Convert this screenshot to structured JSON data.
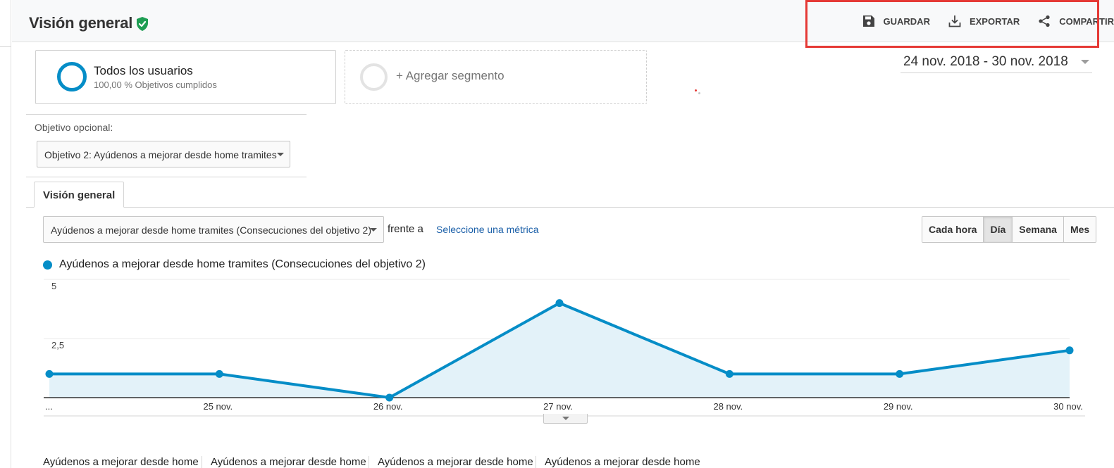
{
  "header": {
    "title": "Visión general",
    "actions": {
      "save": "GUARDAR",
      "export": "EXPORTAR",
      "share": "COMPARTIR"
    }
  },
  "segments": {
    "primary": {
      "name": "Todos los usuarios",
      "detail": "100,00 % Objetivos cumplidos"
    },
    "add_label": "+ Agregar segmento"
  },
  "date_range": "24 nov. 2018 - 30 nov. 2018",
  "goal_option": {
    "label": "Objetivo opcional:",
    "selected": "Objetivo 2: Ayúdenos a mejorar desde home tramites"
  },
  "tabs": [
    {
      "label": "Visión general",
      "active": true
    }
  ],
  "metric_controls": {
    "selected_metric": "Ayúdenos a mejorar desde home tramites (Consecuciones del objetivo 2)",
    "versus_label": "frente a",
    "select_metric_link": "Seleccione una métrica",
    "periods": [
      "Cada hora",
      "Día",
      "Semana",
      "Mes"
    ],
    "active_period": "Día"
  },
  "colors": {
    "accent": "#058dc7",
    "area_fill": "#e3f2f9",
    "highlight": "#e53935",
    "link": "#1a5fa8",
    "verified": "#1e9e53"
  },
  "icons": [
    "verified-shield-icon",
    "save-icon",
    "export-icon",
    "share-icon"
  ],
  "chart_data": {
    "type": "area",
    "series": [
      {
        "name": "Ayúdenos a mejorar desde home tramites (Consecuciones del objetivo 2)",
        "values": [
          1,
          1,
          0,
          4,
          1,
          1,
          2
        ]
      }
    ],
    "x_tick_labels": [
      "...",
      "25 nov.",
      "26 nov.",
      "27 nov.",
      "28 nov.",
      "29 nov.",
      "30 nov."
    ],
    "y_tick_labels": [
      "5",
      "2,5"
    ],
    "ylim": [
      0,
      5
    ],
    "grid": true,
    "legend": "top-left"
  },
  "summary_headers": [
    "Ayúdenos a mejorar desde home tramites",
    "Ayúdenos a mejorar desde home tramites",
    "Ayúdenos a mejorar desde home tramites",
    "Ayúdenos a mejorar desde home tramites"
  ]
}
